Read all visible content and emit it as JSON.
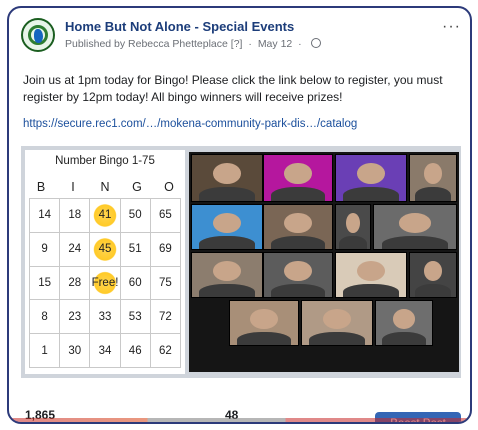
{
  "post": {
    "page_name": "Home But Not Alone - Special Events",
    "publisher": "Published by Rebecca Phetteplace",
    "help_marker": "[?]",
    "separator": "·",
    "date": "May 12",
    "audience_icon": "globe-icon",
    "more_label": "···",
    "message": "Join us at 1pm today for Bingo! Please click the link below to register, you must register by 12pm today! All bingo winners will receive prizes!",
    "link": "https://secure.rec1.com/…/mokena-community-park-dis…/catalog"
  },
  "bingo": {
    "title": "Number Bingo 1-75",
    "letters": [
      "B",
      "I",
      "N",
      "G",
      "O"
    ],
    "rows": [
      [
        {
          "v": "14"
        },
        {
          "v": "18"
        },
        {
          "v": "41",
          "marked": true
        },
        {
          "v": "50"
        },
        {
          "v": "65"
        }
      ],
      [
        {
          "v": "9"
        },
        {
          "v": "24"
        },
        {
          "v": "45",
          "marked": true
        },
        {
          "v": "51"
        },
        {
          "v": "69"
        }
      ],
      [
        {
          "v": "15"
        },
        {
          "v": "28"
        },
        {
          "v": "Free!",
          "marked": true
        },
        {
          "v": "60"
        },
        {
          "v": "75"
        }
      ],
      [
        {
          "v": "8"
        },
        {
          "v": "23"
        },
        {
          "v": "33"
        },
        {
          "v": "53"
        },
        {
          "v": "72"
        }
      ],
      [
        {
          "v": "1"
        },
        {
          "v": "30"
        },
        {
          "v": "34"
        },
        {
          "v": "46"
        },
        {
          "v": "62"
        }
      ]
    ]
  },
  "video_call": {
    "tiles": [
      {
        "bg": "#5a4a3a"
      },
      {
        "bg": "#b5179e"
      },
      {
        "bg": "#6a3fb5"
      },
      {
        "bg": "#8a7a6a"
      },
      {
        "bg": "#3d8fd1"
      },
      {
        "bg": "#7a6655"
      },
      {
        "bg": "#4a4a4a"
      },
      {
        "bg": "#6b6b6b"
      },
      {
        "bg": "#8c7d6e"
      },
      {
        "bg": "#5c5c5c"
      },
      {
        "bg": "#d9cbb8"
      },
      {
        "bg": "#444444"
      },
      {
        "bg": "#a88f78"
      },
      {
        "bg": "#b09a86"
      },
      {
        "bg": "#6e6e6e"
      }
    ]
  },
  "footer": {
    "reach_value": "1,865",
    "engagement_value": "48",
    "boost_label": "Boost Post"
  },
  "colors": {
    "accent": "#3466b5",
    "title": "#1c3d7a",
    "link": "#1b4f9c",
    "marker": "#ffca28"
  }
}
